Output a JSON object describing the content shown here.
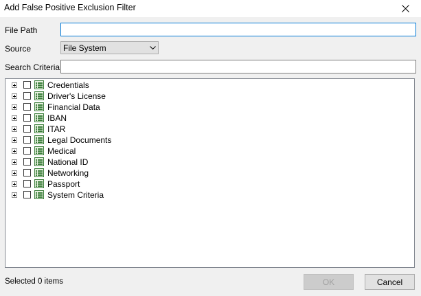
{
  "window": {
    "title": "Add False Positive Exclusion Filter",
    "close_icon": "close-icon"
  },
  "form": {
    "file_path_label": "File Path",
    "file_path_value": "",
    "source_label": "Source",
    "source_value": "File System",
    "search_criteria_label": "Search Criteria",
    "search_criteria_value": ""
  },
  "tree": {
    "expander_icon": "plus-box-icon",
    "item_icon": "list-icon",
    "icon_color": "#3a7d3a",
    "items": [
      {
        "label": "Credentials",
        "checked": false
      },
      {
        "label": "Driver's License",
        "checked": false
      },
      {
        "label": "Financial Data",
        "checked": false
      },
      {
        "label": "IBAN",
        "checked": false
      },
      {
        "label": "ITAR",
        "checked": false
      },
      {
        "label": "Legal Documents",
        "checked": false
      },
      {
        "label": "Medical",
        "checked": false
      },
      {
        "label": "National ID",
        "checked": false
      },
      {
        "label": "Networking",
        "checked": false
      },
      {
        "label": "Passport",
        "checked": false
      },
      {
        "label": "System Criteria",
        "checked": false
      }
    ]
  },
  "footer": {
    "status_text": "Selected 0 items",
    "ok_label": "OK",
    "ok_enabled": false,
    "cancel_label": "Cancel"
  }
}
